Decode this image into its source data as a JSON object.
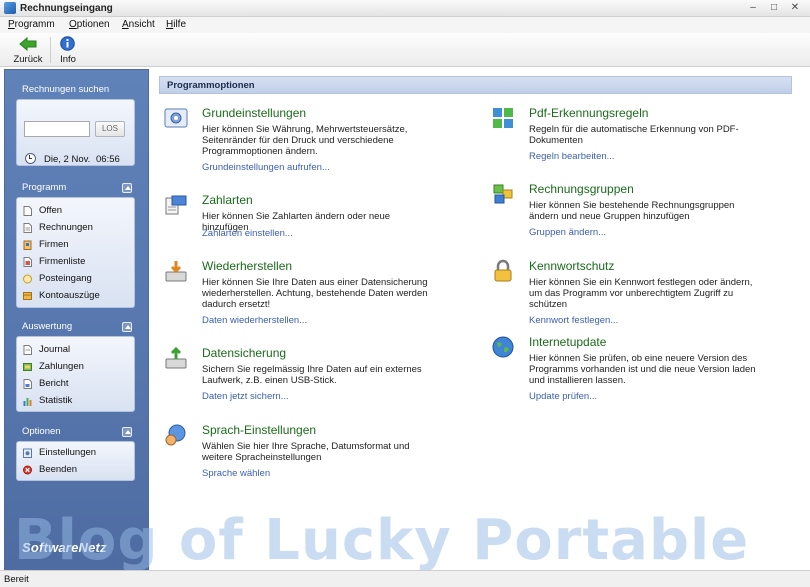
{
  "window": {
    "title": "Rechnungseingang",
    "minimize": "–",
    "maximize": "□",
    "close": "✕"
  },
  "menu": [
    {
      "label": "Programm",
      "accel": "P",
      "rest": "rogramm"
    },
    {
      "label": "Optionen",
      "accel": "O",
      "rest": "ptionen"
    },
    {
      "label": "Ansicht",
      "accel": "A",
      "rest": "nsicht"
    },
    {
      "label": "Hilfe",
      "accel": "H",
      "rest": "ilfe"
    }
  ],
  "toolbar": {
    "back_label": "Zurück",
    "info_label": "Info"
  },
  "sidebar": {
    "search": {
      "title": "Rechnungen suchen",
      "value": "",
      "button_label": "LOS",
      "date": "Die, 2 Nov.",
      "time": "06:56"
    },
    "programm": {
      "title": "Programm",
      "items": [
        "Offen",
        "Rechnungen",
        "Firmen",
        "Firmenliste",
        "Posteingang",
        "Kontoauszüge"
      ]
    },
    "auswertung": {
      "title": "Auswertung",
      "items": [
        "Journal",
        "Zahlungen",
        "Bericht",
        "Statistik"
      ]
    },
    "optionen": {
      "title": "Optionen",
      "items": [
        "Einstellungen",
        "Beenden"
      ]
    },
    "brand": "SoftwareNetz"
  },
  "content": {
    "header": "Programmoptionen",
    "left": [
      {
        "title": "Grundeinstellungen",
        "desc": "Hier können Sie Währung, Mehrwertsteuersätze, Seitenränder für den Druck und verschiedene Programmoptionen ändern.",
        "link": "Grundeinstellungen aufrufen..."
      },
      {
        "title": "Zahlarten",
        "desc": "Hier können Sie Zahlarten ändern oder neue hinzufügen",
        "link": "Zahlarten einstellen..."
      },
      {
        "title": "Wiederherstellen",
        "desc": "Hier können Sie Ihre Daten aus einer Datensicherung wiederherstellen. Achtung, bestehende Daten werden dadurch ersetzt!",
        "link": "Daten wiederherstellen..."
      },
      {
        "title": "Datensicherung",
        "desc": "Sichern Sie regelmässig Ihre Daten auf ein externes Laufwerk, z.B. einen USB-Stick.",
        "link": "Daten jetzt sichern..."
      },
      {
        "title": "Sprach-Einstellungen",
        "desc": "Wählen Sie hier Ihre Sprache, Datumsformat und weitere Spracheinstellungen",
        "link": "Sprache wählen"
      }
    ],
    "right": [
      {
        "title": "Pdf-Erkennungsregeln",
        "desc": "Regeln für die automatische Erkennung von PDF-Dokumenten",
        "link": "Regeln bearbeiten..."
      },
      {
        "title": "Rechnungsgruppen",
        "desc": "Hier können Sie bestehende Rechnungsgruppen ändern und neue Gruppen hinzufügen",
        "link": "Gruppen ändern..."
      },
      {
        "title": "Kennwortschutz",
        "desc": "Hier können Sie ein Kennwort festlegen oder ändern, um das Programm vor unberechtigtem Zugriff zu schützen",
        "link": "Kennwort festlegen..."
      },
      {
        "title": "Internetupdate",
        "desc": "Hier können Sie prüfen, ob eine neuere Version des Programms vorhanden ist und die neue Version laden und installieren lassen.",
        "link": "Update prüfen..."
      }
    ]
  },
  "status": {
    "text": "Bereit"
  },
  "watermark": "Blog of Lucky Portable",
  "colors": {
    "sidebar": "#5a7bb4",
    "title_green": "#1a6b1a",
    "link_blue": "#3c5fb1"
  }
}
